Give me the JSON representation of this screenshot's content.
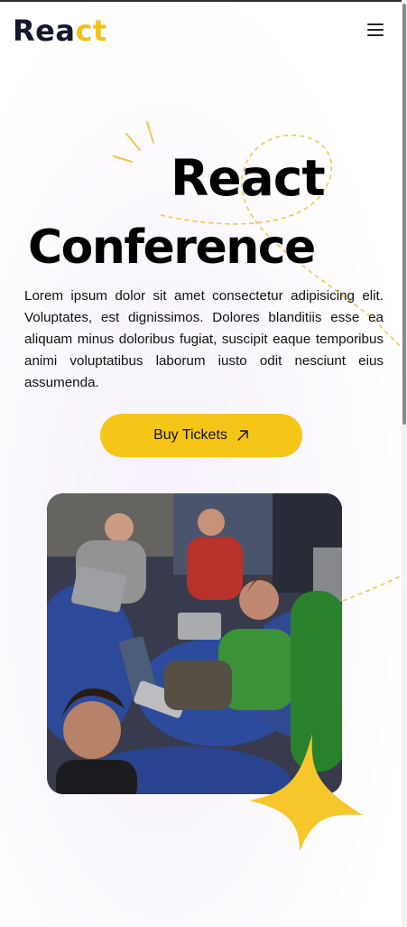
{
  "header": {
    "logo_main": "Rea",
    "logo_accent": "ct"
  },
  "hero": {
    "title_line1": "React",
    "title_line2": "Conference",
    "description": "Lorem ipsum dolor sit amet consectetur adipisicing elit. Voluptates, est dignissimos. Dolores blanditiis esse ea aliquam minus doloribus fugiat, suscipit eaque temporibus animi voluptatibus laborum iusto odit nesciunt eius assumenda.",
    "cta_label": "Buy Tickets"
  },
  "icons": {
    "menu": "hamburger-menu-icon",
    "cta_arrow": "arrow-up-right-icon",
    "decor_star": "star-icon",
    "decor_sparkle": "sparkle-lines-icon"
  },
  "colors": {
    "accent": "#f5c518",
    "logo_text": "#14162b",
    "decor_dash": "#f0c84a"
  },
  "image": {
    "subject": "people sitting on beanbags using laptops at a conference"
  }
}
